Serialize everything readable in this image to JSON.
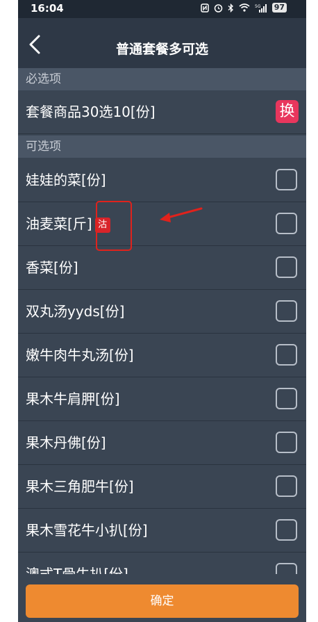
{
  "status_bar": {
    "time": "16:04",
    "icons": [
      "nfc-icon",
      "alarm-icon",
      "bluetooth-icon",
      "wifi-icon",
      "5g-signal-icon"
    ],
    "battery": "97"
  },
  "header": {
    "title": "普通套餐多可选",
    "back_icon": "chevron-left-icon"
  },
  "required_section": {
    "header": "必选项",
    "item": {
      "label": "套餐商品30选10[份]",
      "action_label": "换"
    }
  },
  "optional_section": {
    "header": "可选项",
    "items": [
      {
        "label": "娃娃的菜[份]",
        "checked": false
      },
      {
        "label": "油麦菜[斤]",
        "badge": "沽",
        "checked": false
      },
      {
        "label": "香菜[份]",
        "checked": false
      },
      {
        "label": "双丸汤yyds[份]",
        "checked": false
      },
      {
        "label": "嫩牛肉牛丸汤[份]",
        "checked": false
      },
      {
        "label": "果木牛肩胛[份]",
        "checked": false
      },
      {
        "label": "果木丹佛[份]",
        "checked": false
      },
      {
        "label": "果木三角肥牛[份]",
        "checked": false
      },
      {
        "label": "果木雪花牛小扒[份]",
        "checked": false
      },
      {
        "label": "澳式T骨牛扒[份]",
        "checked": false
      }
    ]
  },
  "footer": {
    "confirm_label": "确定"
  },
  "colors": {
    "background": "#3a4553",
    "swap_badge": "#e8365d",
    "sold_out_badge": "#d8242a",
    "confirm_button": "#ee8a30",
    "annotation": "#e0221c"
  }
}
